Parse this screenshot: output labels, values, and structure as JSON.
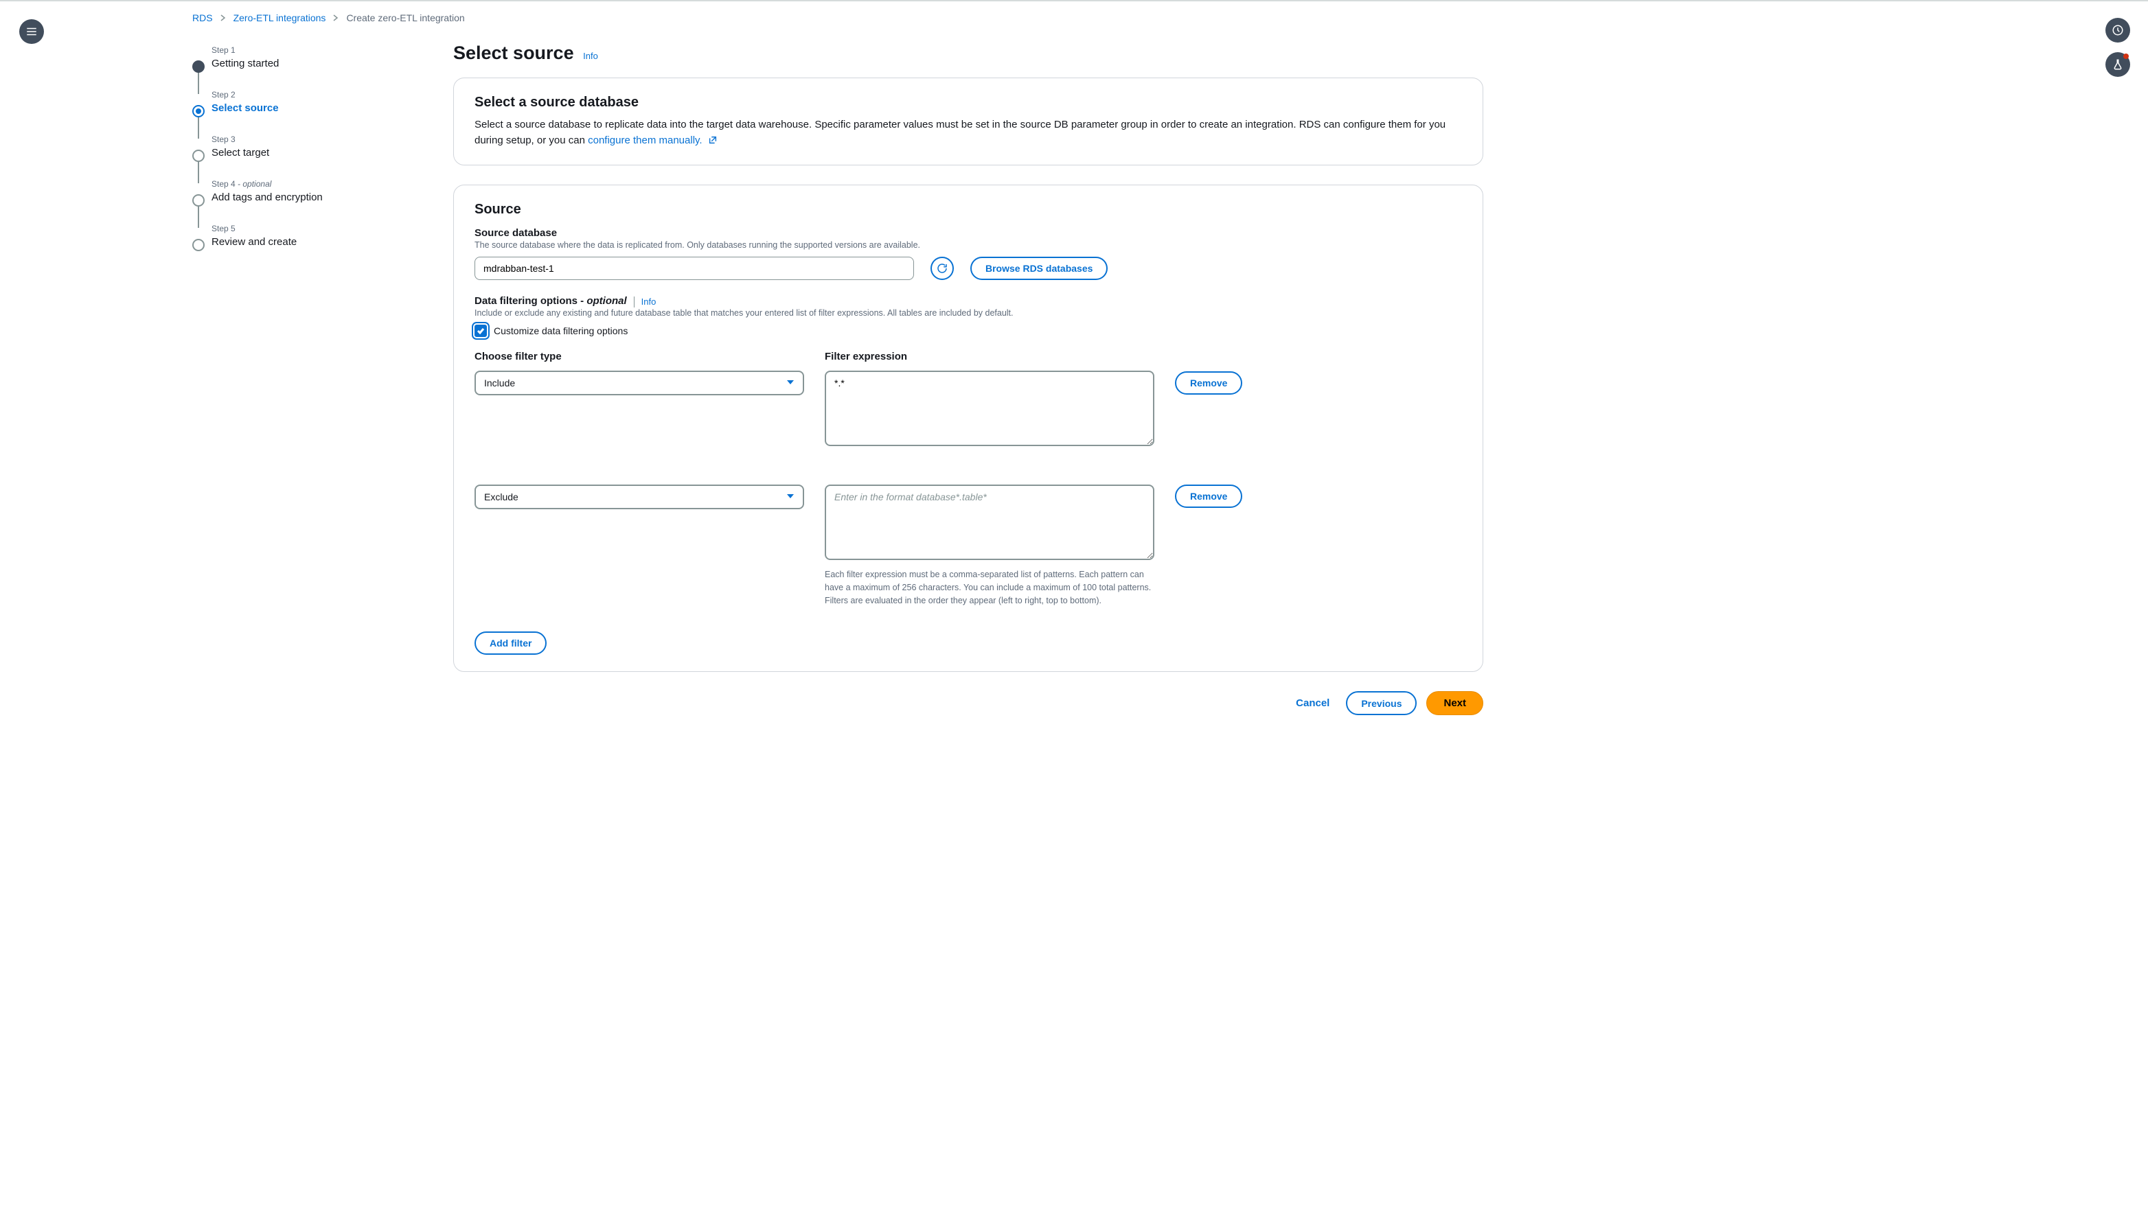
{
  "breadcrumbs": {
    "rds": "RDS",
    "zei": "Zero-ETL integrations",
    "current": "Create zero-ETL integration"
  },
  "steps": [
    {
      "small": "Step 1",
      "main": "Getting started"
    },
    {
      "small": "Step 2",
      "main": "Select source"
    },
    {
      "small": "Step 3",
      "main": "Select target"
    },
    {
      "small": "Step 4",
      "opt": " - optional",
      "main": "Add tags and encryption"
    },
    {
      "small": "Step 5",
      "main": "Review and create"
    }
  ],
  "page": {
    "title": "Select source",
    "info": "Info"
  },
  "select_source_card": {
    "title": "Select a source database",
    "desc_pre": "Select a source database to replicate data into the target data warehouse. Specific parameter values must be set in the source DB parameter group in order to create an integration. RDS can configure them for you during setup, or you can ",
    "desc_link": "configure them manually."
  },
  "source_card": {
    "title": "Source",
    "db_label": "Source database",
    "db_hint": "The source database where the data is replicated from. Only databases running the supported versions are available.",
    "db_value": "mdrabban-test-1",
    "browse": "Browse RDS databases",
    "filter_title_pre": "Data filtering options - ",
    "filter_title_opt": "optional",
    "filter_info": "Info",
    "filter_hint": "Include or exclude any existing and future database table that matches your entered list of filter expressions. All tables are included by default.",
    "checkbox_label": "Customize data filtering options",
    "filter_type_header": "Choose filter type",
    "filter_expr_header": "Filter expression",
    "filters": [
      {
        "type": "Include",
        "expr": "*.*",
        "placeholder": ""
      },
      {
        "type": "Exclude",
        "expr": "",
        "placeholder": "Enter in the format database*.table*"
      }
    ],
    "remove": "Remove",
    "constraint": "Each filter expression must be a comma-separated list of patterns. Each pattern can have a maximum of 256 characters. You can include a maximum of 100 total patterns. Filters are evaluated in the order they appear (left to right, top to bottom).",
    "add_filter": "Add filter"
  },
  "footer": {
    "cancel": "Cancel",
    "previous": "Previous",
    "next": "Next"
  }
}
